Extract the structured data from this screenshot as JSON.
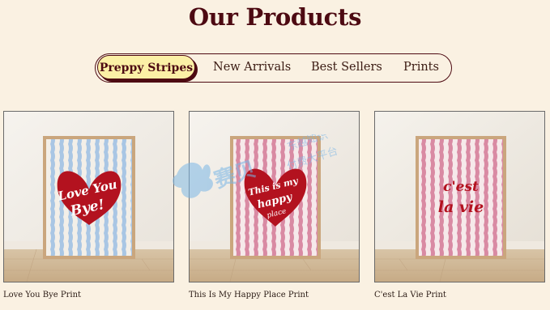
{
  "page": {
    "title": "Our Products"
  },
  "tabs": [
    {
      "label": "Preppy Stripes",
      "active": true
    },
    {
      "label": "New Arrivals",
      "active": false
    },
    {
      "label": "Best Sellers",
      "active": false
    },
    {
      "label": "Prints",
      "active": false
    }
  ],
  "products": [
    {
      "name": "Love You Bye Print",
      "art_text_line1": "Love You",
      "art_text_line2": "Bye!",
      "stripe_color": "#a9c6e4",
      "heart_color": "#b3121f"
    },
    {
      "name": "This Is My Happy Place Print",
      "art_text_line1": "This is my",
      "art_text_line2": "happy",
      "art_text_line3": "place",
      "stripe_color": "#d98aa3",
      "heart_color": "#b3121f"
    },
    {
      "name": "C'est La Vie Print",
      "art_text_line1": "c'est",
      "art_text_line2": "la vie",
      "stripe_color": "#d98aa3",
      "text_color": "#b3121f"
    }
  ],
  "watermark": {
    "line1": "赛贝",
    "line2": "东越知识",
    "line3": "付费大平台"
  },
  "colors": {
    "accent": "#4d0a12",
    "active_tab_bg": "#fbf0a6",
    "background": "#faf1e2"
  }
}
